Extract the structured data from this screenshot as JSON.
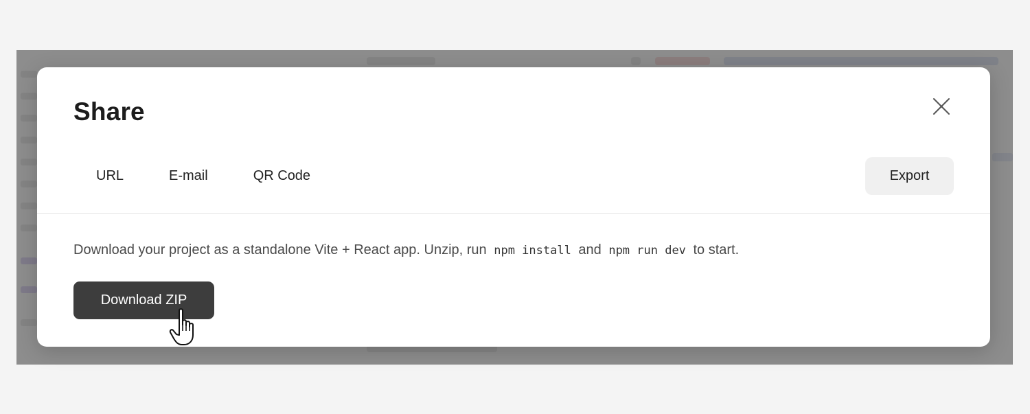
{
  "modal": {
    "title": "Share",
    "tabs": [
      {
        "label": "URL"
      },
      {
        "label": "E-mail"
      },
      {
        "label": "QR Code"
      }
    ],
    "export_label": "Export",
    "description": {
      "part1": "Download your project as a standalone Vite + React app. Unzip, run",
      "code1": "npm install",
      "part2": "and",
      "code2": "npm run dev",
      "part3": "to start."
    },
    "download_label": "Download ZIP"
  },
  "icons": {
    "close": "close-icon",
    "cursor": "hand-pointer-icon"
  },
  "colors": {
    "primary_button": "#3d3d3d",
    "secondary_button": "#f0f0f0",
    "overlay": "#6e6e6e"
  }
}
